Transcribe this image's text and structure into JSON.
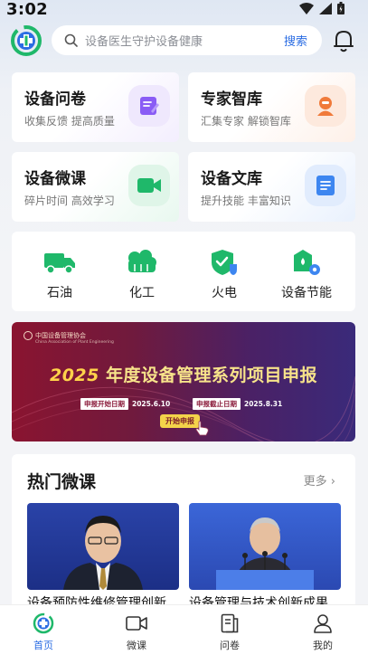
{
  "status": {
    "time": "3:02"
  },
  "search": {
    "placeholder": "设备医生守护设备健康",
    "button": "搜索"
  },
  "cards": [
    {
      "title": "设备问卷",
      "subtitle": "收集反馈 提高质量",
      "icon": "edit-icon"
    },
    {
      "title": "专家智库",
      "subtitle": "汇集专家 解锁智库",
      "icon": "expert-icon"
    },
    {
      "title": "设备微课",
      "subtitle": "碎片时间 高效学习",
      "icon": "video-icon"
    },
    {
      "title": "设备文库",
      "subtitle": "提升技能 丰富知识",
      "icon": "document-icon"
    }
  ],
  "categories": [
    {
      "label": "石油",
      "icon": "truck-icon"
    },
    {
      "label": "化工",
      "icon": "chemical-icon"
    },
    {
      "label": "火电",
      "icon": "shield-power-icon"
    },
    {
      "label": "设备节能",
      "icon": "energy-saving-icon"
    }
  ],
  "banner": {
    "org": "中国设备管理协会",
    "org_en": "China Association of Plant Engineering",
    "year": "2025",
    "title": "年度设备管理系列项目申报",
    "start_label": "申报开始日期",
    "start_date": "2025.6.10",
    "end_label": "申报截止日期",
    "end_date": "2025.8.31",
    "cta": "开始申报"
  },
  "hot": {
    "heading": "热门微课",
    "more": "更多",
    "videos": [
      {
        "title": "设备预防性维修管理创新"
      },
      {
        "title": "设备管理与技术创新成果"
      }
    ]
  },
  "tabs": [
    {
      "label": "首页",
      "icon": "home-icon"
    },
    {
      "label": "微课",
      "icon": "video-course-icon"
    },
    {
      "label": "问卷",
      "icon": "questionnaire-icon"
    },
    {
      "label": "我的",
      "icon": "user-icon"
    }
  ],
  "colors": {
    "accent": "#2b6de3",
    "green": "#1fb86a",
    "purple": "#8a5cf5",
    "orange": "#f07a3a"
  }
}
